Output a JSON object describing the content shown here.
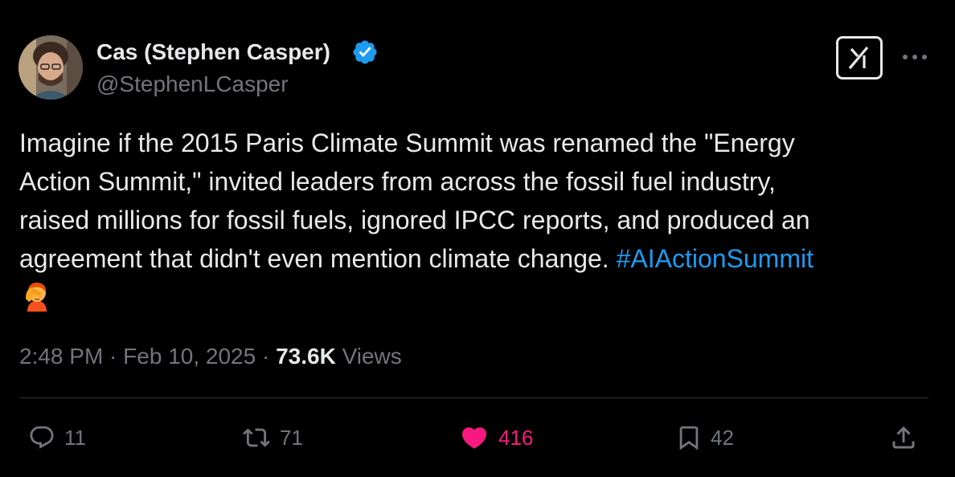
{
  "author": {
    "name": "Cas (Stephen Casper)",
    "handle": "@StephenLCasper",
    "verified": true
  },
  "tweet": {
    "lines": [
      "Imagine if the 2015 Paris Climate Summit was renamed the \"Energy",
      "Action Summit,\" invited leaders from across the fossil fuel industry,",
      "raised millions for fossil fuels, ignored IPCC reports, and produced an",
      "agreement that didn't even mention climate change. "
    ],
    "hashtag": "#AIActionSummit",
    "emoji": "facepalm"
  },
  "meta": {
    "time": "2:48 PM",
    "separator": " · ",
    "date": "Feb 10, 2025",
    "views_count": "73.6K",
    "views_label": "Views"
  },
  "actions": {
    "replies": "11",
    "reposts": "71",
    "likes": "416",
    "bookmarks": "42"
  },
  "colors": {
    "background": "#000000",
    "text": "#e7e9ea",
    "secondary": "#71767b",
    "link": "#1d9bf0",
    "like": "#f91880",
    "verified": "#1d9bf0"
  },
  "icons": [
    "verified-badge-icon",
    "grok-icon",
    "more-icon",
    "reply-icon",
    "repost-icon",
    "like-icon",
    "bookmark-icon",
    "share-icon"
  ]
}
